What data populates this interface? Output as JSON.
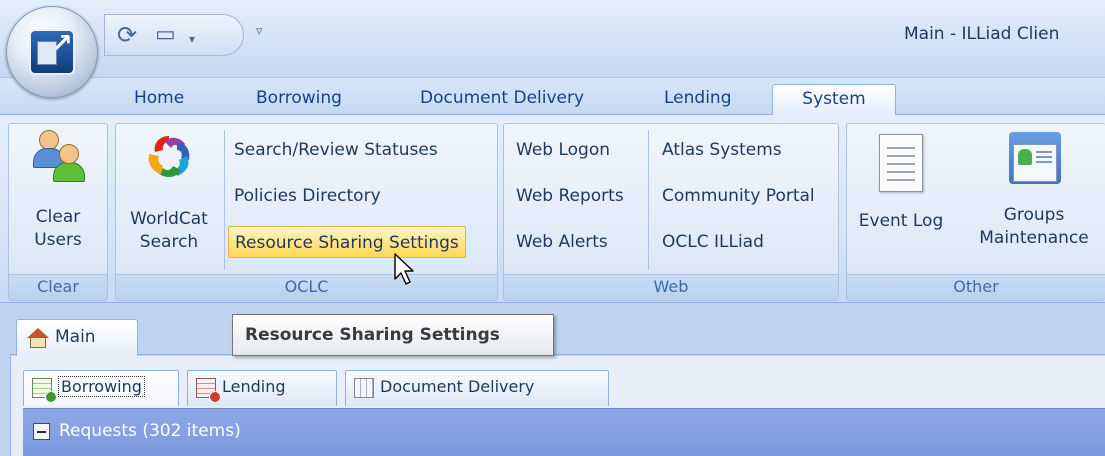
{
  "window": {
    "title": "Main - ILLiad Clien"
  },
  "quick_access": {
    "refresh_icon": "refresh-icon",
    "window_icon": "window-icon",
    "dropdown_glyph": "▾",
    "customize_glyph": "▿"
  },
  "ribbon_tabs": [
    "Home",
    "Borrowing",
    "Document Delivery",
    "Lending",
    "System"
  ],
  "active_tab": "System",
  "groups": {
    "clear": {
      "caption": "Clear",
      "buttons": {
        "clear_users": "Clear\nUsers"
      }
    },
    "oclc": {
      "caption": "OCLC",
      "worldcat": "WorldCat\nSearch",
      "items": [
        "Search/Review Statuses",
        "Policies Directory",
        "Resource Sharing Settings"
      ]
    },
    "web": {
      "caption": "Web",
      "col1": [
        "Web Logon",
        "Web Reports",
        "Web Alerts"
      ],
      "col2": [
        "Atlas Systems",
        "Community Portal",
        "OCLC ILLiad"
      ]
    },
    "other": {
      "caption": "Other",
      "event_log": "Event Log",
      "groups_maintenance": "Groups\nMaintenance"
    }
  },
  "tooltip": "Resource Sharing Settings",
  "document_tabs": {
    "main": "Main"
  },
  "sub_tabs": [
    "Borrowing",
    "Lending",
    "Document Delivery"
  ],
  "requests": {
    "label": "Requests  (302 items)"
  },
  "colors": {
    "highlight": "#ffe58a",
    "requests_bar": "#8fa8e8",
    "title_text": "#1e395b"
  }
}
